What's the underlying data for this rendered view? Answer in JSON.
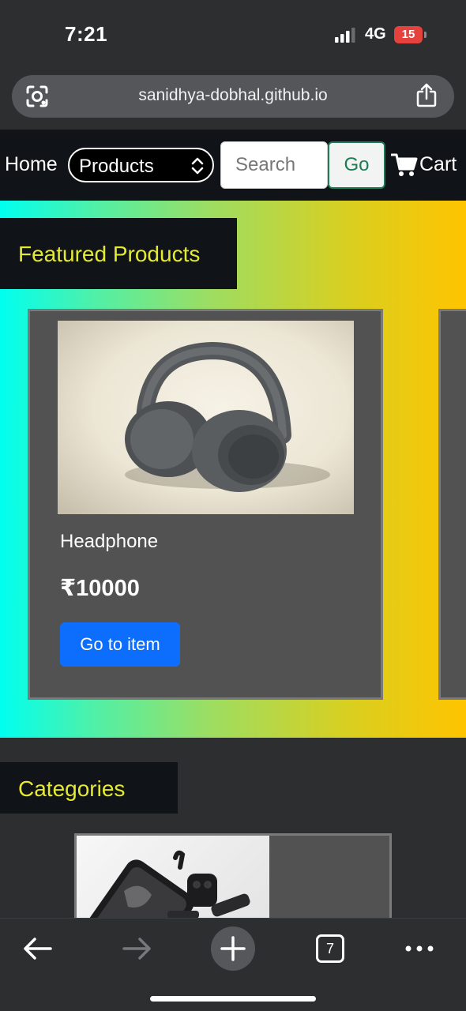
{
  "status_bar": {
    "time": "7:21",
    "network": "4G",
    "battery": "15",
    "battery_color": "#e5413d"
  },
  "browser": {
    "url": "sanidhya-dobhal.github.io",
    "tab_count": "7",
    "icons": [
      "lens-icon",
      "share-icon",
      "back-icon",
      "forward-icon",
      "plus-icon",
      "tabs-icon",
      "more-icon"
    ]
  },
  "nav": {
    "home_label": "Home",
    "category_select_value": "Products",
    "search_placeholder": "Search",
    "go_label": "Go",
    "cart_label": "Cart",
    "go_accent_color": "#1e7b54"
  },
  "featured": {
    "title": "Featured Products",
    "title_color": "#e4ea31",
    "products": [
      {
        "name": "Headphone",
        "price": "₹10000",
        "button_label": "Go to item",
        "button_color": "#0d6efd",
        "image": "headphone-image"
      }
    ]
  },
  "categories": {
    "title": "Categories",
    "items": [
      {
        "image": "electronics-category-image"
      }
    ]
  }
}
